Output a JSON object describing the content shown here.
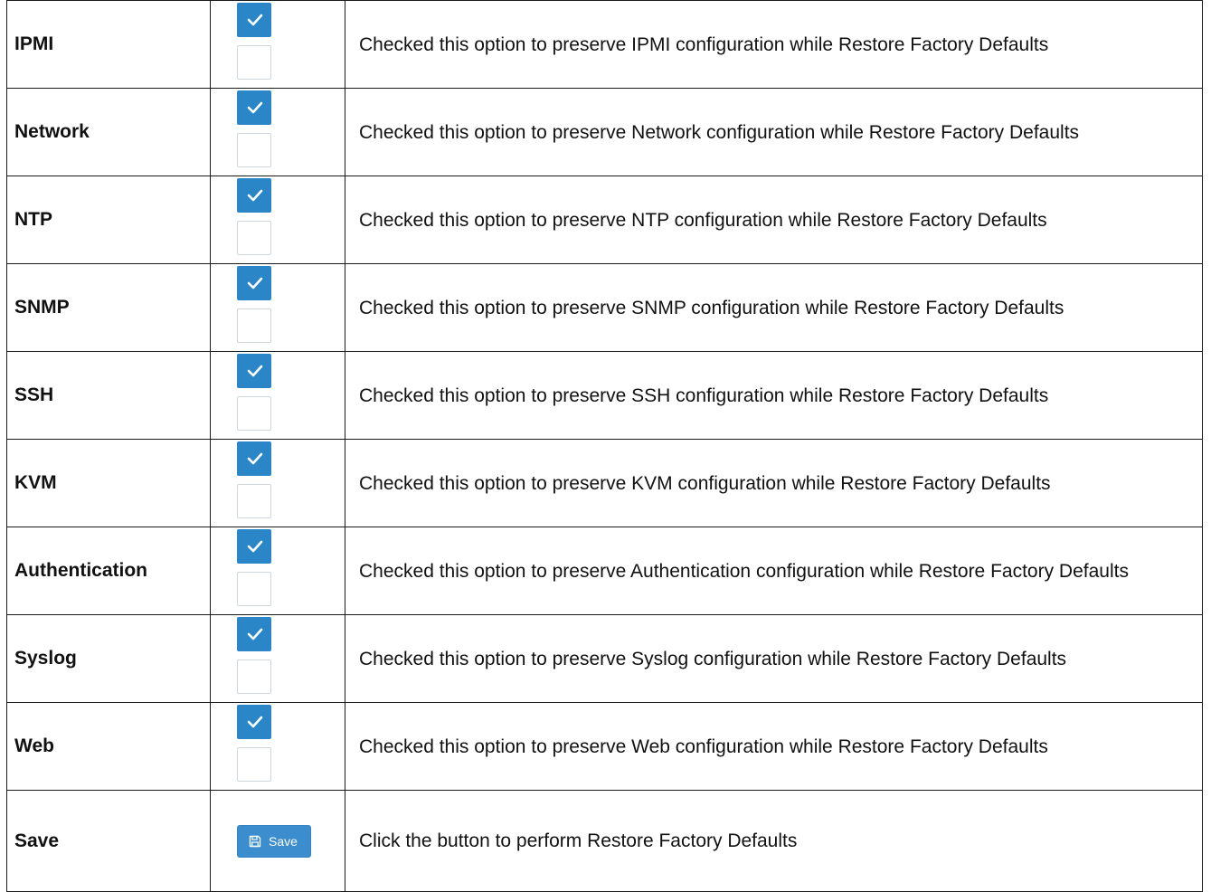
{
  "rows": [
    {
      "label": "IPMI",
      "description": "Checked this option to preserve IPMI configuration while Restore Factory Defaults",
      "checked": true
    },
    {
      "label": "Network",
      "description": "Checked this option to preserve Network configuration while Restore Factory Defaults",
      "checked": true
    },
    {
      "label": "NTP",
      "description": "Checked this option to preserve NTP configuration while Restore Factory Defaults",
      "checked": true
    },
    {
      "label": "SNMP",
      "description": "Checked this option to preserve SNMP configuration while Restore Factory Defaults",
      "checked": true
    },
    {
      "label": "SSH",
      "description": "Checked this option to preserve SSH configuration while Restore Factory Defaults",
      "checked": true
    },
    {
      "label": "KVM",
      "description": "Checked this option to preserve KVM configuration while Restore Factory Defaults",
      "checked": true
    },
    {
      "label": "Authentication",
      "description": "Checked this option to preserve Authentication configuration while Restore Factory Defaults",
      "checked": true
    },
    {
      "label": "Syslog",
      "description": "Checked this option to preserve Syslog configuration while Restore Factory Defaults",
      "checked": true
    },
    {
      "label": "Web",
      "description": "Checked this option to preserve Web configuration while Restore Factory Defaults",
      "checked": true
    }
  ],
  "save_row": {
    "label": "Save",
    "button_label": "Save",
    "button_icon": "save-icon",
    "description": "Click the button to perform Restore Factory Defaults"
  },
  "colors": {
    "checkbox_checked": "#2b86c8",
    "button": "#3c8dce",
    "border": "#1a1a1a"
  }
}
